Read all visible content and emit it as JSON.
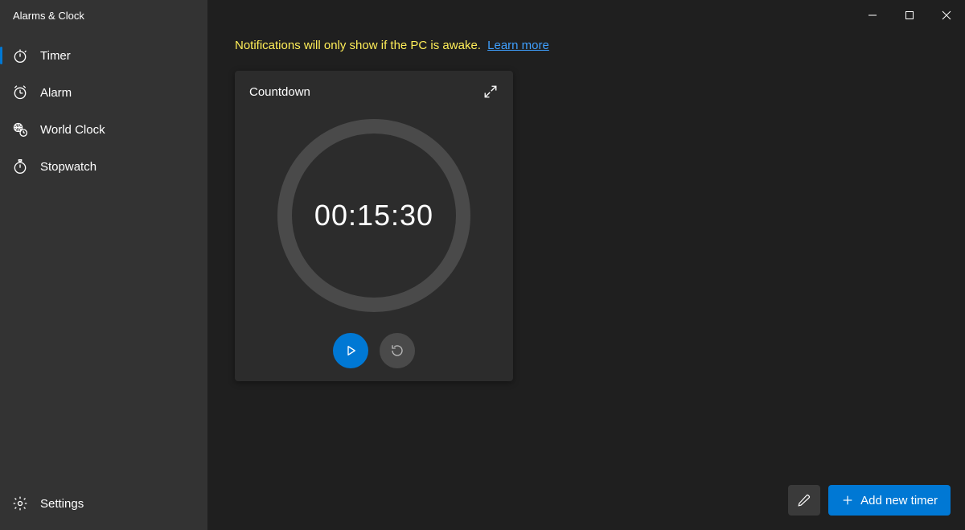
{
  "app_title": "Alarms & Clock",
  "sidebar": {
    "items": [
      {
        "label": "Timer"
      },
      {
        "label": "Alarm"
      },
      {
        "label": "World Clock"
      },
      {
        "label": "Stopwatch"
      }
    ],
    "settings_label": "Settings"
  },
  "notice": {
    "message": "Notifications will only show if the PC is awake.",
    "link_label": "Learn more"
  },
  "timer_card": {
    "title": "Countdown",
    "time": "00:15:30"
  },
  "bottom_bar": {
    "add_label": "Add new timer"
  }
}
